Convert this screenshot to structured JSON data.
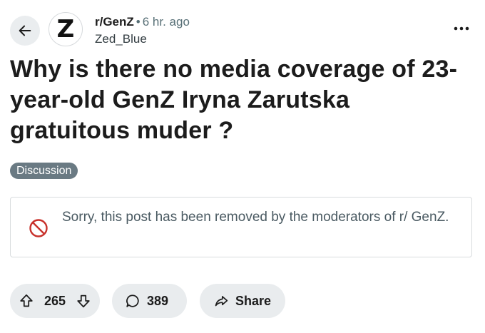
{
  "post": {
    "subreddit": "r/GenZ",
    "separator": "•",
    "time_ago": "6 hr. ago",
    "author": "Zed_Blue",
    "avatar_letter": "Z",
    "title": "Why is there no media coverage of 23-year-old GenZ Iryna Zarutska gratuitous muder ?",
    "flair": "Discussion",
    "removed_notice": "Sorry, this post has been removed by the moderators of r/ GenZ."
  },
  "actions": {
    "upvotes": "265",
    "comments": "389",
    "share_label": "Share"
  },
  "icons": {
    "back": "arrow-left-icon",
    "more": "more-horizontal-icon",
    "removed": "prohibited-icon",
    "upvote": "upvote-arrow-icon",
    "downvote": "downvote-arrow-icon",
    "comment": "comment-bubble-icon",
    "share": "share-arrow-icon"
  },
  "colors": {
    "flair_background": "#6a7a83",
    "removed_icon": "#c8312b",
    "pill_background": "#e9ecee"
  }
}
